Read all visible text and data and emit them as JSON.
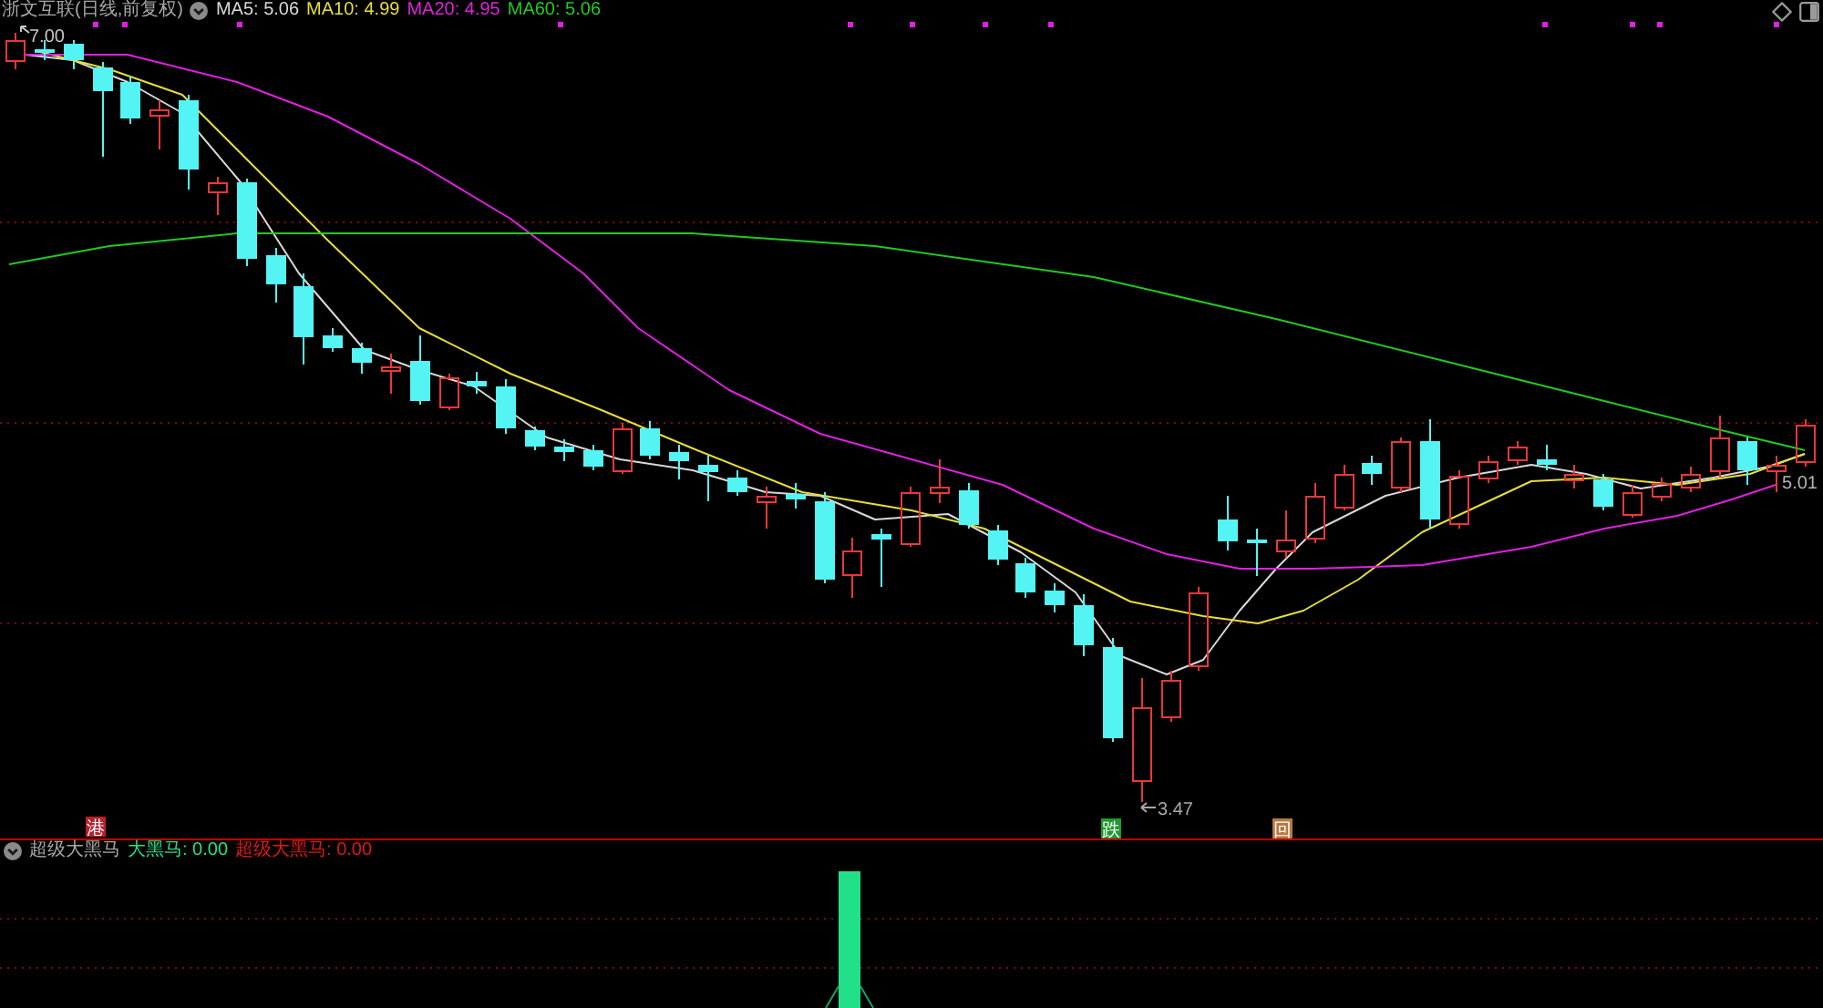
{
  "main_chart": {
    "title": "浙文互联(日线,前复权)",
    "indicators": [
      {
        "label": "MA5: 5.06",
        "color": "#d8d8d8"
      },
      {
        "label": "MA10: 4.99",
        "color": "#e6de3a"
      },
      {
        "label": "MA20: 4.95",
        "color": "#e020e0"
      },
      {
        "label": "MA60: 5.06",
        "color": "#22c822"
      }
    ],
    "price_labels": {
      "high": "7.00",
      "low": "3.47",
      "last": "5.01"
    },
    "event_badges": [
      {
        "label": "港",
        "color": "#b8202c"
      },
      {
        "label": "跌",
        "color": "#1f9a30"
      },
      {
        "label": "回",
        "color": "#b87840"
      }
    ]
  },
  "sub_chart": {
    "title": "超级大黑马",
    "indicators": [
      {
        "label": "大黑马: 0.00",
        "color": "#22e088"
      },
      {
        "label": "超级大黑马: 0.00",
        "color": "#e01818"
      }
    ]
  }
}
